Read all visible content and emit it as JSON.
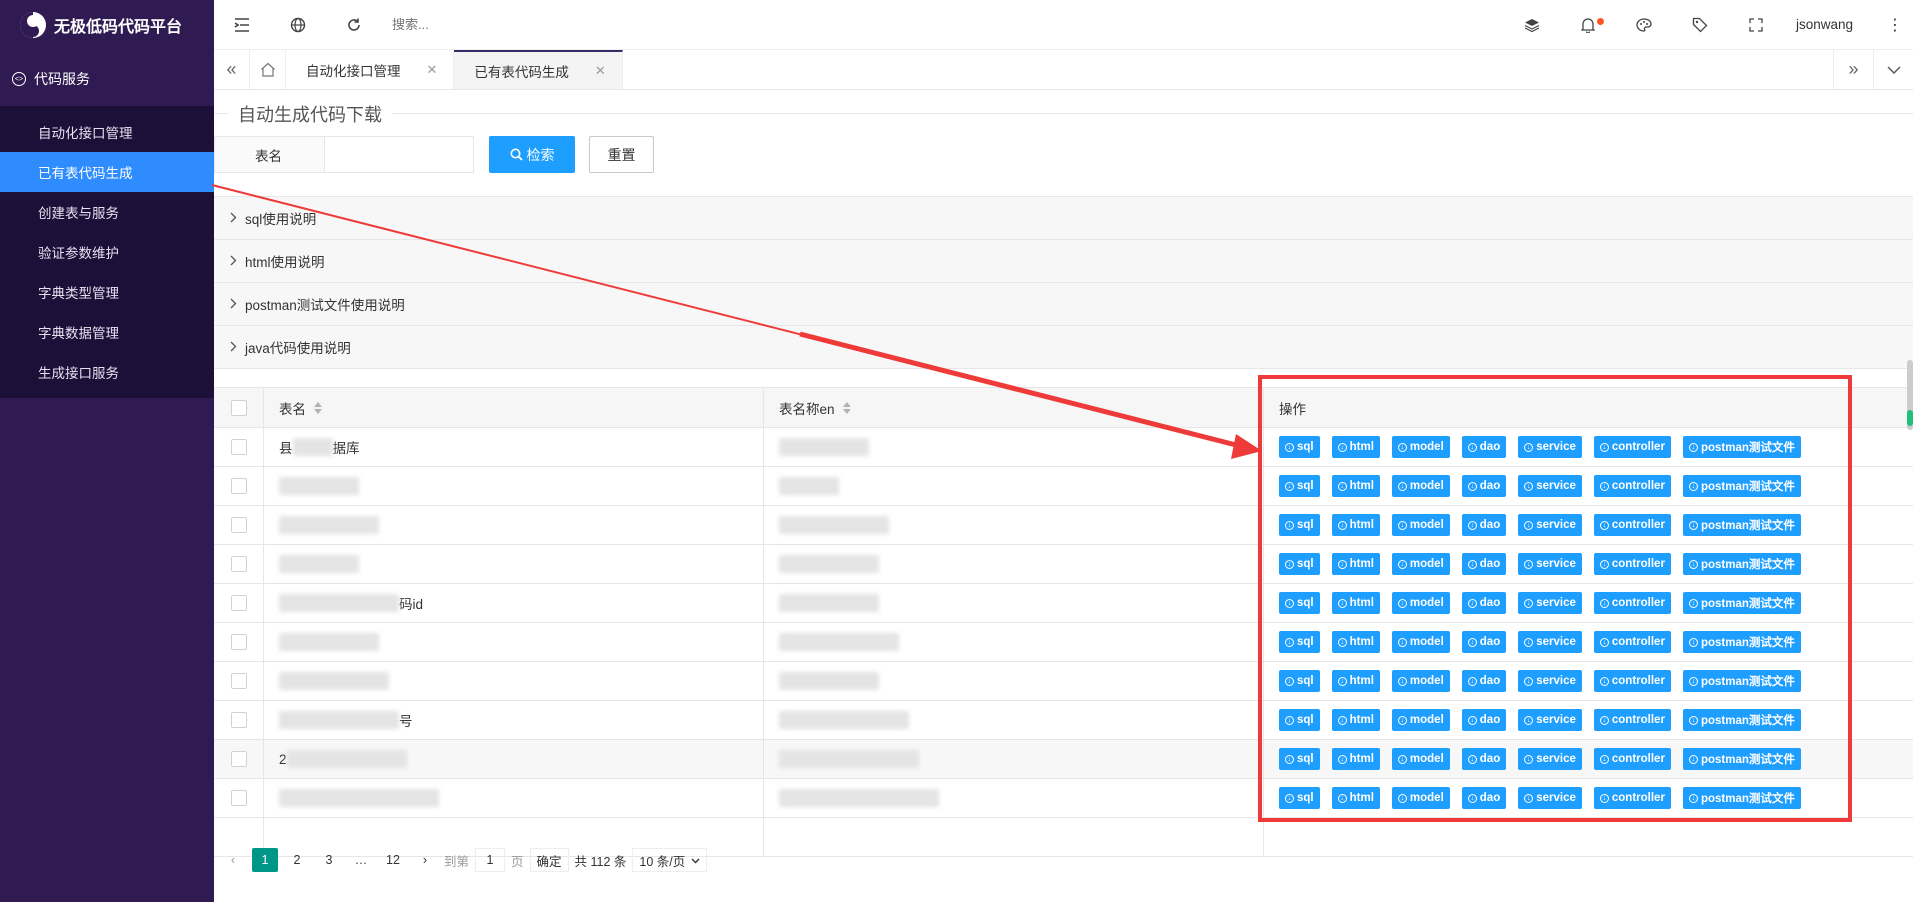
{
  "app": {
    "title": "无极低码代码平台"
  },
  "sidebar": {
    "group_label": "代码服务",
    "items": [
      {
        "label": "自动化接口管理"
      },
      {
        "label": "已有表代码生成"
      },
      {
        "label": "创建表与服务"
      },
      {
        "label": "验证参数维护"
      },
      {
        "label": "字典类型管理"
      },
      {
        "label": "字典数据管理"
      },
      {
        "label": "生成接口服务"
      }
    ]
  },
  "topbar": {
    "search_placeholder": "搜索...",
    "username": "jsonwang"
  },
  "tabs": [
    {
      "label": "自动化接口管理"
    },
    {
      "label": "已有表代码生成"
    }
  ],
  "main": {
    "section_title": "自动生成代码下载",
    "form": {
      "label": "表名",
      "input_value": "",
      "search_label": "检索",
      "reset_label": "重置"
    },
    "collapse": [
      {
        "label": "sql使用说明"
      },
      {
        "label": "html使用说明"
      },
      {
        "label": "postman测试文件使用说明"
      },
      {
        "label": "java代码使用说明"
      }
    ],
    "table": {
      "headers": {
        "name": "表名",
        "name_en": "表名称en",
        "ops": "操作"
      },
      "rows": [
        {
          "name_prefix": "县",
          "name_suffix": "据库",
          "en_suffix": ""
        },
        {
          "name_prefix": "",
          "name_suffix": "",
          "en_suffix": ""
        },
        {
          "name_prefix": "",
          "name_suffix": "",
          "en_suffix": ""
        },
        {
          "name_prefix": "",
          "name_suffix": "",
          "en_suffix": ""
        },
        {
          "name_prefix": "",
          "name_suffix": "码id",
          "en_suffix": ""
        },
        {
          "name_prefix": "",
          "name_suffix": "",
          "en_suffix": ""
        },
        {
          "name_prefix": "",
          "name_suffix": "",
          "en_suffix": ""
        },
        {
          "name_prefix": "",
          "name_suffix": "号",
          "en_suffix": ""
        },
        {
          "name_prefix": "2",
          "name_suffix": "",
          "en_suffix": ""
        },
        {
          "name_prefix": "",
          "name_suffix": "",
          "en_suffix": ""
        }
      ],
      "op_buttons": [
        "sql",
        "html",
        "model",
        "dao",
        "service",
        "controller",
        "postman测试文件"
      ]
    },
    "pager": {
      "pages": [
        "1",
        "2",
        "3",
        "…",
        "12"
      ],
      "goto_label": "到第",
      "goto_value": "1",
      "page_unit": "页",
      "confirm_label": "确定",
      "total_label": "共 112 条",
      "size_label": "10 条/页"
    }
  },
  "colors": {
    "sidebar_bg": "#2f1b52",
    "submenu_bg": "#1d1038",
    "active_item": "#2f8cff",
    "primary": "#1e9fff",
    "pager_active": "#009688",
    "annotation": "#ef3a3a"
  }
}
